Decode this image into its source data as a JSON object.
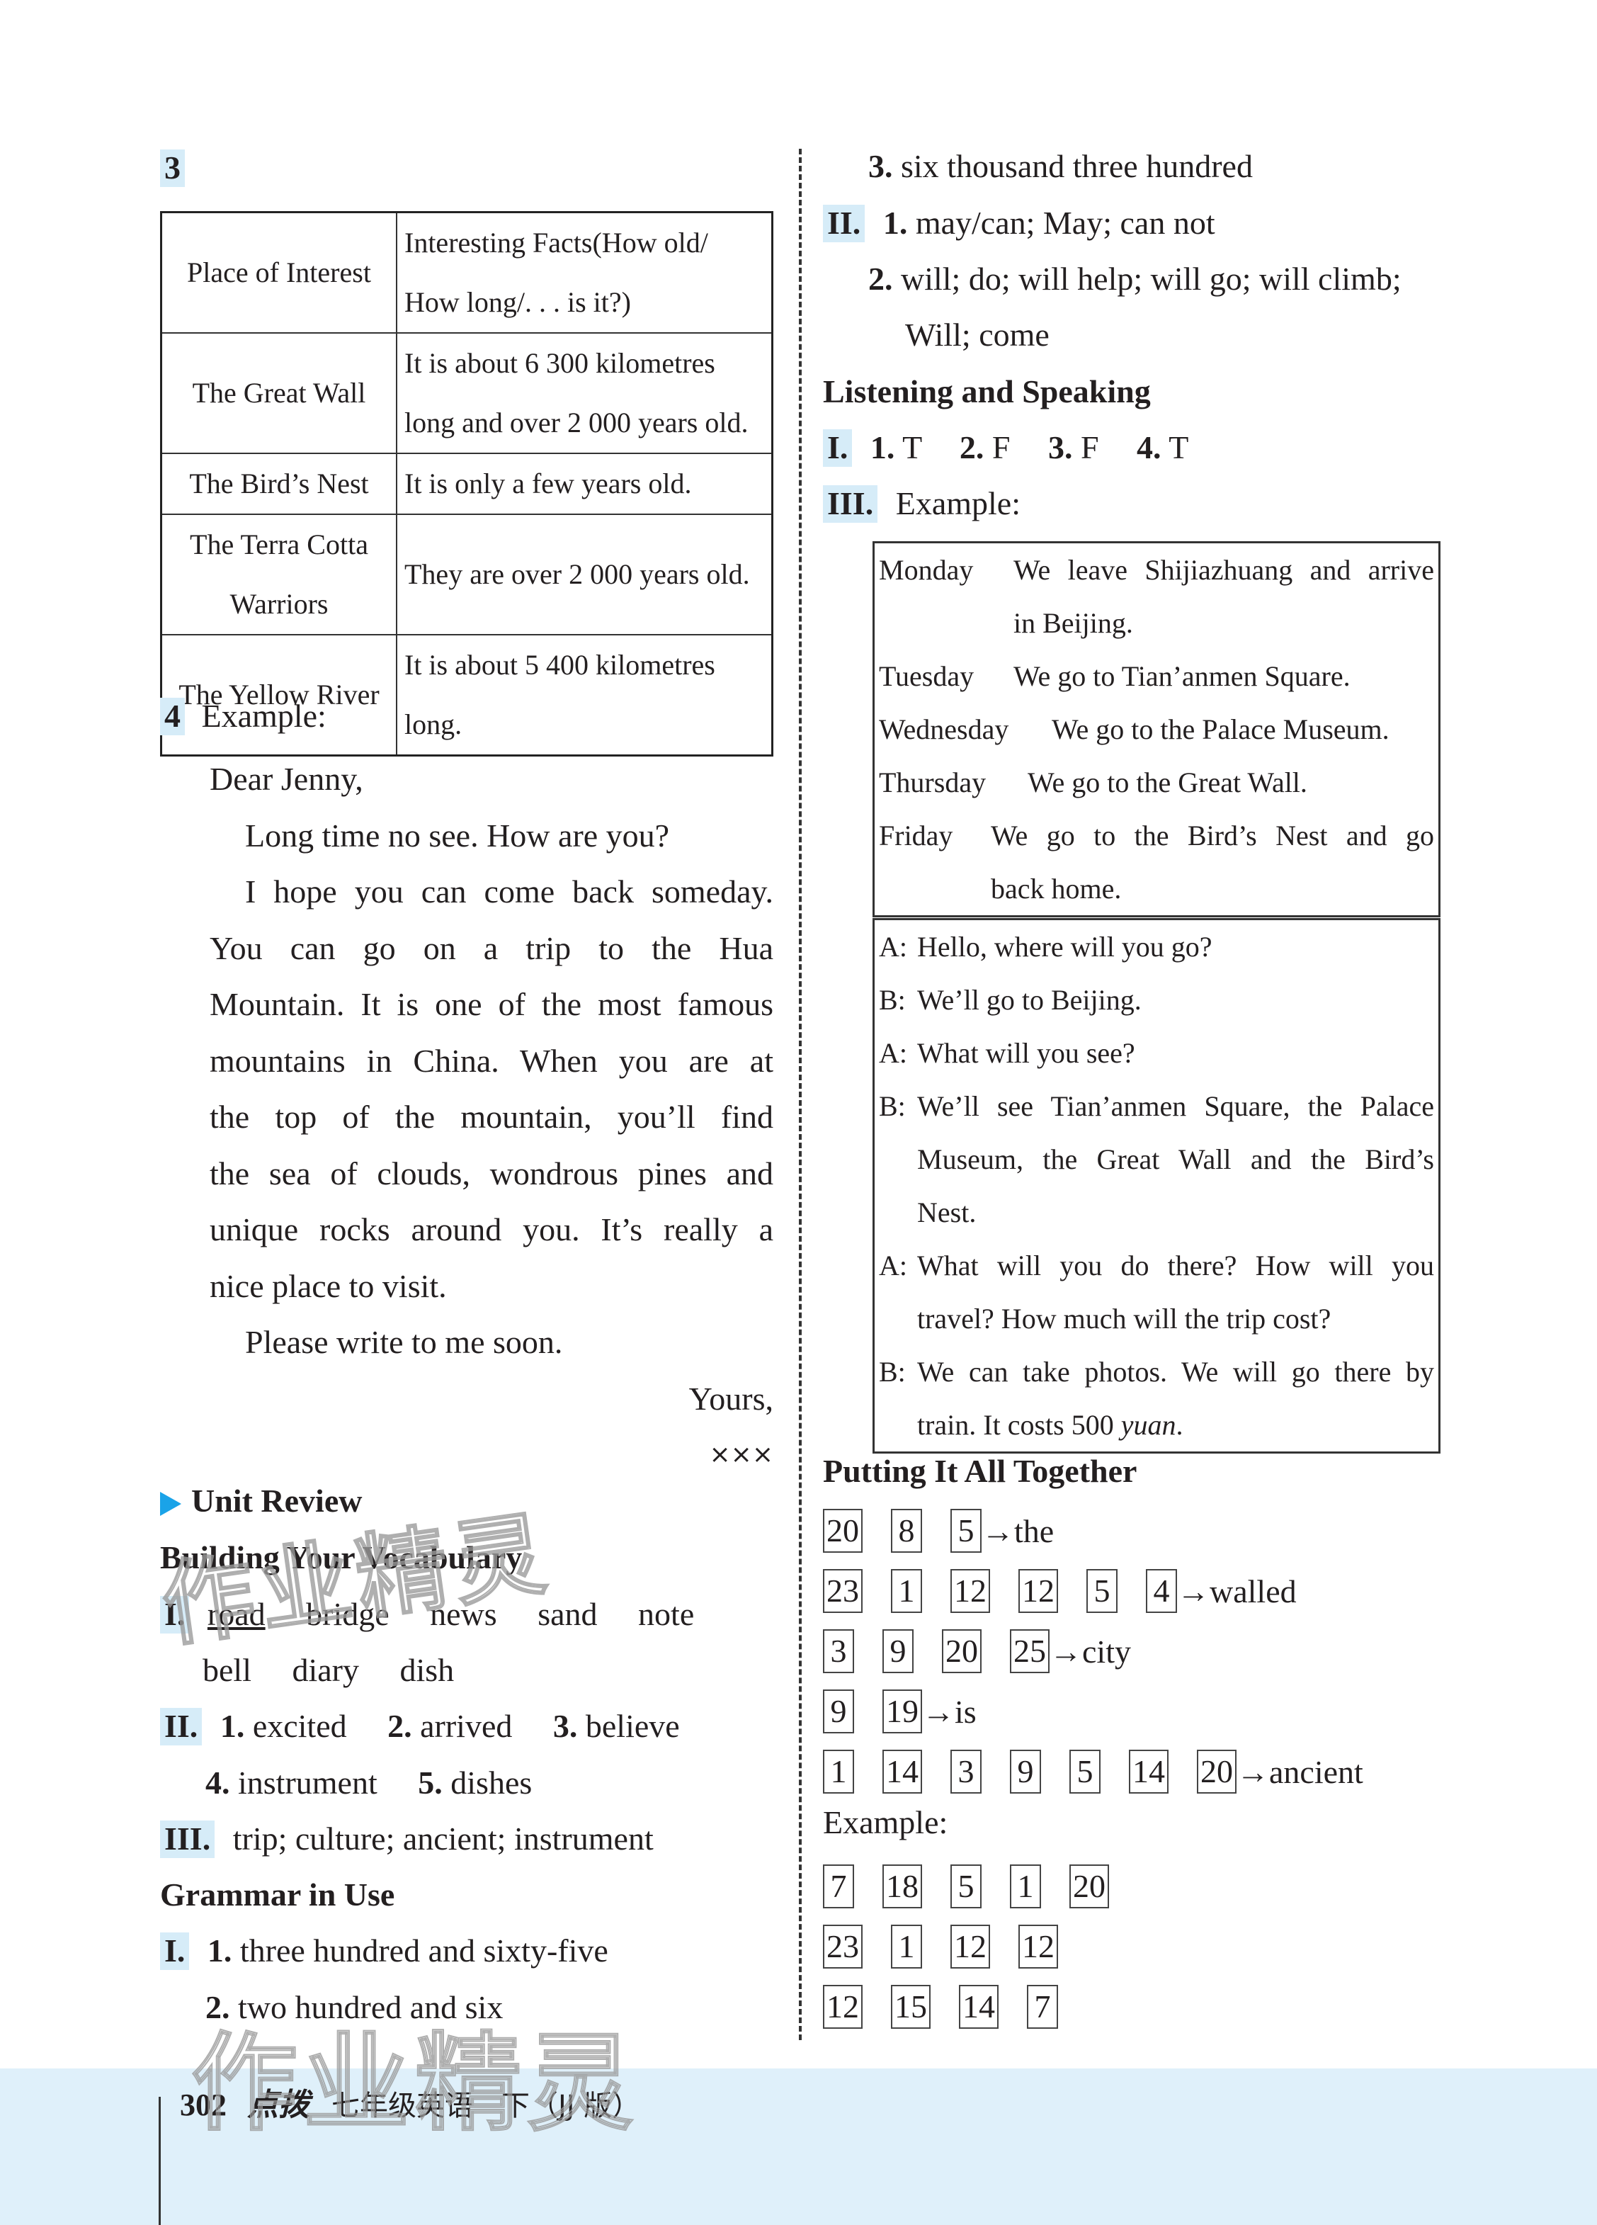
{
  "left": {
    "q3": {
      "number": "3",
      "table": {
        "headers": [
          "Place of Interest",
          "Interesting Facts(How old/ How long/. . . is it?)"
        ],
        "rows": [
          [
            "The Great Wall",
            "It is about 6 300 kilometres long and over 2 000 years old."
          ],
          [
            "The Bird’s Nest",
            "It is only a few years old."
          ],
          [
            "The Terra Cotta Warriors",
            "They are over 2 000 years old."
          ],
          [
            "The Yellow River",
            "It is about 5 400 kilometres long."
          ]
        ]
      }
    },
    "q4": {
      "number": "4",
      "label": "Example:",
      "greeting": "Dear Jenny,",
      "para1": "Long time no see. How are you?",
      "para2_lines": [
        "I hope you can come back someday.",
        "You can go on a trip to the Hua",
        "Mountain. It is one of the most famous",
        "mountains in China. When you are at",
        "the top of the mountain, you’ll find",
        "the sea of clouds, wondrous pines and",
        "unique rocks around you. It’s really a",
        "nice place to visit."
      ],
      "para3": "Please write to me soon.",
      "closing": "Yours,",
      "signature": "×××"
    },
    "unit_review": {
      "title": "Unit Review",
      "vocab_heading": "Building Your Vocabulary",
      "vocab_I": {
        "tag": "I.",
        "words_line1": [
          "road",
          "bridge",
          "news",
          "sand",
          "note"
        ],
        "words_line2": [
          "bell",
          "diary",
          "dish"
        ]
      },
      "vocab_II": {
        "tag": "II.",
        "items": [
          {
            "n": "1.",
            "text": "excited"
          },
          {
            "n": "2.",
            "text": "arrived"
          },
          {
            "n": "3.",
            "text": "believe"
          },
          {
            "n": "4.",
            "text": "instrument"
          },
          {
            "n": "5.",
            "text": "dishes"
          }
        ]
      },
      "vocab_III": {
        "tag": "III.",
        "text": "trip; culture; ancient; instrument"
      },
      "grammar_heading": "Grammar in Use",
      "grammar_I": {
        "tag": "I.",
        "items": [
          {
            "n": "1.",
            "text": "three hundred and sixty-five"
          },
          {
            "n": "2.",
            "text": "two hundred and six"
          }
        ]
      }
    }
  },
  "right": {
    "grammar_I_3": {
      "n": "3.",
      "text": "six thousand three hundred"
    },
    "grammar_II": {
      "tag": "II.",
      "items": [
        {
          "n": "1.",
          "text": "may/can; May; can not"
        },
        {
          "n": "2.",
          "text": "will; do; will help; will go; will climb;",
          "cont": "Will; come"
        }
      ]
    },
    "listening_heading": "Listening and Speaking",
    "listening_I": {
      "tag": "I.",
      "items": [
        {
          "n": "1.",
          "text": "T"
        },
        {
          "n": "2.",
          "text": "F"
        },
        {
          "n": "3.",
          "text": "F"
        },
        {
          "n": "4.",
          "text": "T"
        }
      ]
    },
    "listening_III": {
      "tag": "III.",
      "label": "Example:"
    },
    "schedule": [
      {
        "day": "Monday",
        "lines": [
          "We leave Shijiazhuang and arrive",
          "in Beijing."
        ]
      },
      {
        "day": "Tuesday",
        "lines": [
          "We go to Tian’anmen Square."
        ]
      },
      {
        "day": "Wednesday",
        "lines": [
          "We go to the Palace Museum."
        ]
      },
      {
        "day": "Thursday",
        "lines": [
          "We go to the Great Wall."
        ]
      },
      {
        "day": "Friday",
        "lines": [
          "We go to the Bird’s Nest and go",
          "back home."
        ]
      }
    ],
    "dialogue": [
      {
        "speaker": "A:",
        "lines": [
          "Hello, where will you go?"
        ]
      },
      {
        "speaker": "B:",
        "lines": [
          "We’ll go to Beijing."
        ]
      },
      {
        "speaker": "A:",
        "lines": [
          "What will you see?"
        ]
      },
      {
        "speaker": "B:",
        "lines": [
          "We’ll see Tian’anmen Square, the Palace",
          "Museum, the Great Wall and the Bird’s",
          "Nest."
        ]
      },
      {
        "speaker": "A:",
        "lines": [
          "What will you do there? How will you",
          "travel? How much will the trip cost?"
        ]
      },
      {
        "speaker": "B:",
        "lines": [
          "We can take photos. We will go there by",
          "train. It costs 500 "
        ],
        "italic_tail": "yuan",
        "tail_end": "."
      }
    ],
    "putting_heading": "Putting It All Together",
    "code_rows": [
      {
        "numbers": [
          "20",
          "8",
          "5"
        ],
        "word": "the"
      },
      {
        "numbers": [
          "23",
          "1",
          "12",
          "12",
          "5",
          "4"
        ],
        "word": "walled"
      },
      {
        "numbers": [
          "3",
          "9",
          "20",
          "25"
        ],
        "word": "city"
      },
      {
        "numbers": [
          "9",
          "19"
        ],
        "word": "is"
      },
      {
        "numbers": [
          "1",
          "14",
          "3",
          "9",
          "5",
          "14",
          "20"
        ],
        "word": "ancient"
      }
    ],
    "example_label": "Example:",
    "example_rows": [
      {
        "numbers": [
          "7",
          "18",
          "5",
          "1",
          "20"
        ]
      },
      {
        "numbers": [
          "23",
          "1",
          "12",
          "12"
        ]
      },
      {
        "numbers": [
          "12",
          "15",
          "14",
          "7"
        ]
      }
    ],
    "arrow": "→"
  },
  "footer": {
    "page_number": "302",
    "brand": "点拨",
    "book_title": "七年级英语　下（JJ 版）"
  },
  "watermark": "作业精灵",
  "colors": {
    "tag_bg": "#d6ecf8",
    "accent_triangle": "#1aa3e8",
    "footer_bg": "#dff0fa"
  }
}
